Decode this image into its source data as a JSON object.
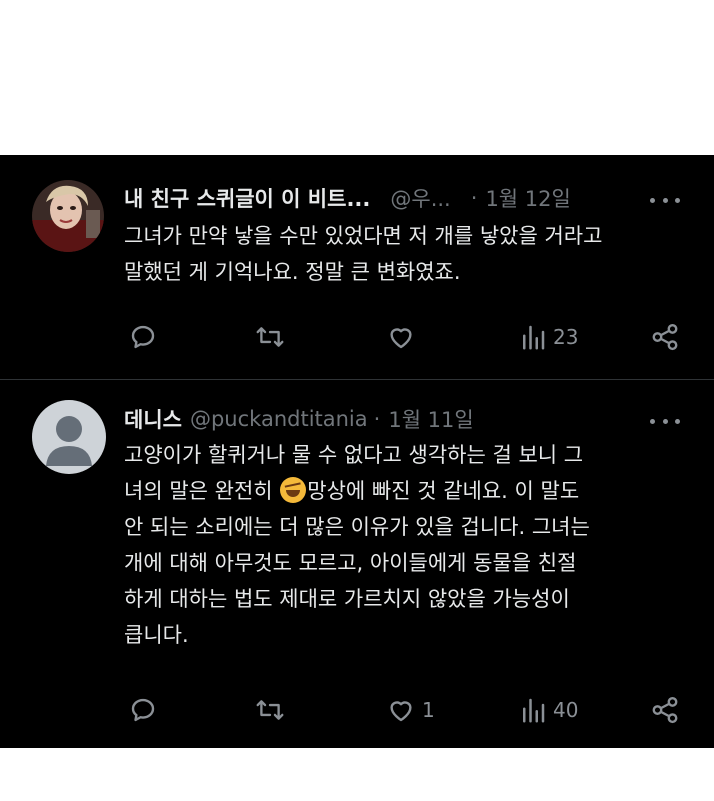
{
  "tweets": [
    {
      "author_name": "내 친구 스퀴글이 이 비트...",
      "handle": "@우...",
      "separator": "·",
      "date": "1월 12일",
      "lines": [
        "그녀가 만약 낳을 수만 있었다면 저 개를 낳았을 거라고",
        "말했던 게 기억나요. 정말 큰 변화였죠."
      ],
      "reply_count": "",
      "retweet_count": "",
      "like_count": "",
      "view_count": "23"
    },
    {
      "author_name": "데니스",
      "handle": "@puckandtitania",
      "separator": "·",
      "date": "1월 11일",
      "lines": [
        "고양이가 할퀴거나 물 수 없다고 생각하는 걸 보니 그",
        "녀의 말은 완전히",
        "망상에 빠진 것 같네요. 이 말도",
        "안 되는 소리에는 더 많은 이유가 있을 겁니다. 그녀는",
        "개에 대해 아무것도 모르고, 아이들에게 동물을 친절",
        "하게 대하는 법도 제대로 가르치지 않았을 가능성이",
        "큽니다."
      ],
      "emoji": "rolling-on-floor-laughing",
      "reply_count": "",
      "retweet_count": "",
      "like_count": "1",
      "view_count": "40"
    }
  ],
  "colors": {
    "background": "#000000",
    "text": "#e7e9ea",
    "muted": "#71767b",
    "divider": "#2f3336",
    "page": "#ffffff"
  }
}
